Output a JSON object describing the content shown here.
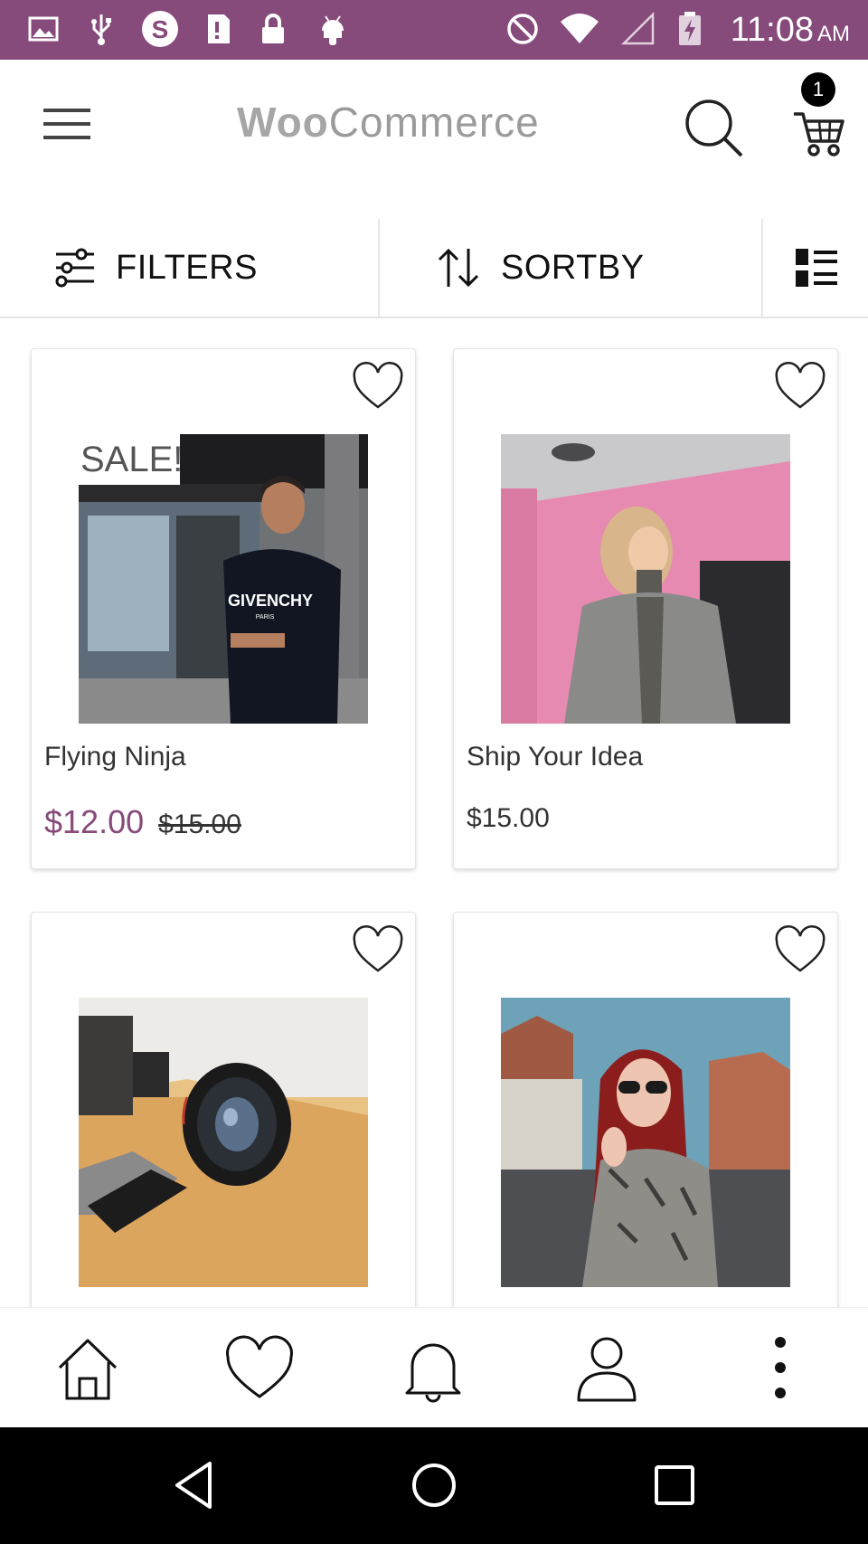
{
  "status_bar": {
    "time": "11:08",
    "ampm": "AM",
    "background": "#864a7b",
    "icons": [
      "image-icon",
      "usb-icon",
      "skype-icon",
      "sd-card-icon",
      "lock-icon",
      "android-icon",
      "do-not-disturb-icon",
      "wifi-icon",
      "signal-icon",
      "battery-charging-icon"
    ]
  },
  "app_bar": {
    "logo_bold": "Woo",
    "logo_light": "Commerce",
    "cart_count": "1"
  },
  "toolbar": {
    "filters_label": "FILTERS",
    "sort_label": "SORTBY"
  },
  "products": [
    {
      "title": "Flying Ninja",
      "sale_badge": "SALE!",
      "price": "$12.00",
      "old_price": "$15.00",
      "image": "man-in-givenchy-sweater-photo",
      "sweater_text": "GIVENCHY",
      "sweater_subtext": "PARIS"
    },
    {
      "title": "Ship Your Idea",
      "price": "$15.00",
      "image": "woman-in-grey-coat-photo"
    },
    {
      "title": "",
      "image": "camera-lens-photo"
    },
    {
      "title": "",
      "image": "red-haired-woman-photo"
    }
  ],
  "bottom_nav": [
    "home-icon",
    "heart-icon",
    "bell-icon",
    "user-icon",
    "more-vertical-icon"
  ],
  "system_nav": [
    "back-icon",
    "home-circle-icon",
    "recents-icon"
  ],
  "colors": {
    "accent": "#864a7b",
    "sale_price": "#864a7b"
  }
}
